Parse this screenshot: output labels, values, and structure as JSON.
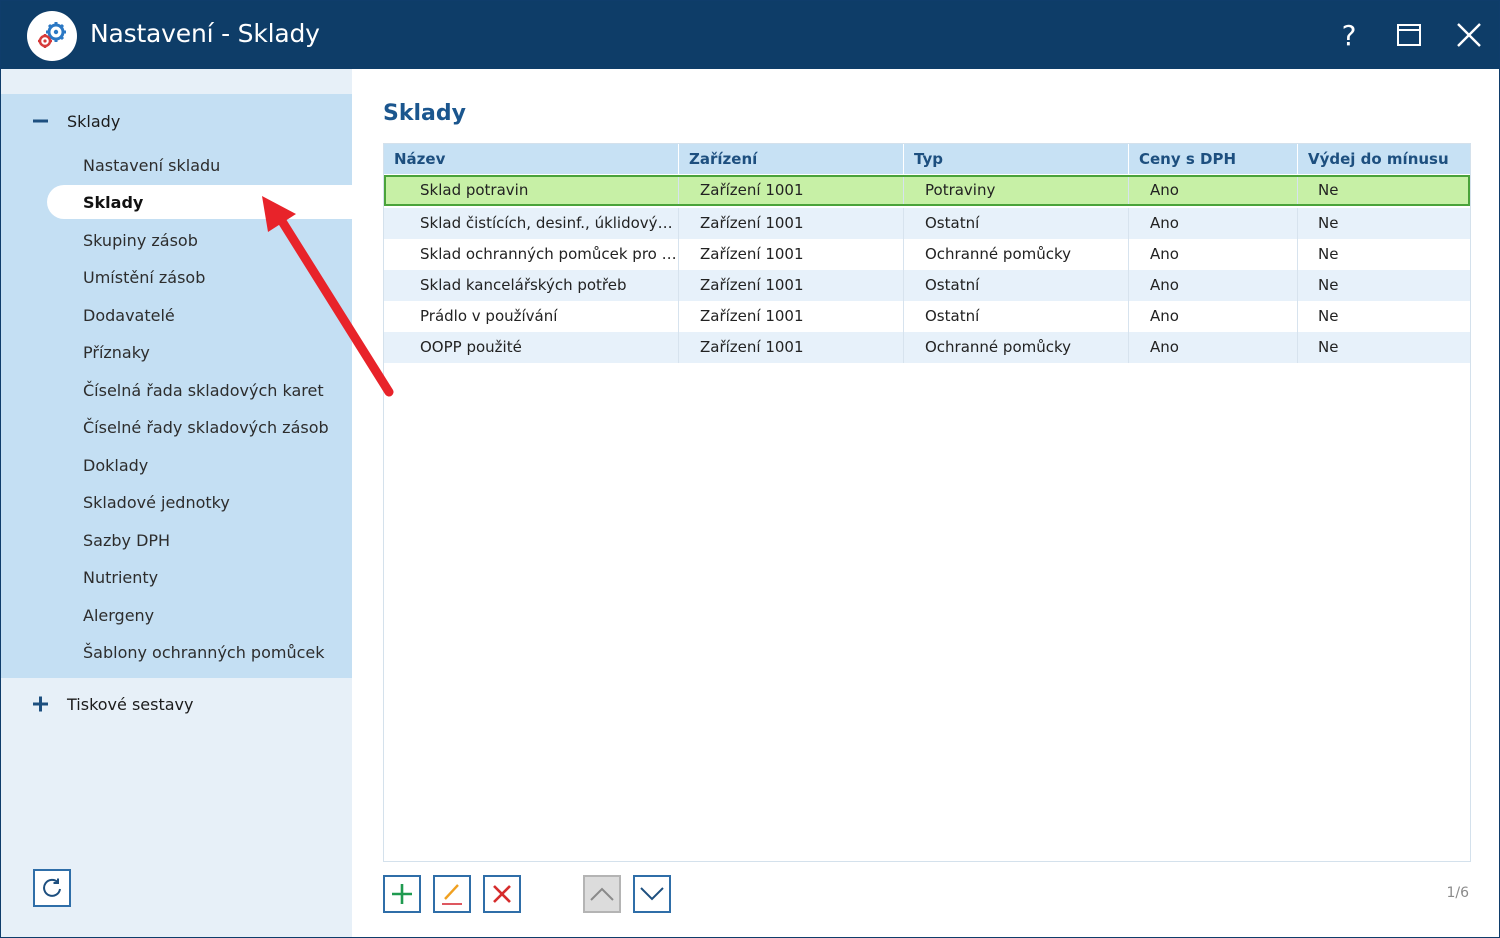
{
  "window": {
    "title": "Nastavení - Sklady",
    "help_label": "?"
  },
  "sidebar": {
    "groups": [
      {
        "label": "Sklady",
        "expanded": true,
        "items": [
          {
            "label": "Nastavení skladu"
          },
          {
            "label": "Sklady",
            "active": true
          },
          {
            "label": "Skupiny zásob"
          },
          {
            "label": "Umístění zásob"
          },
          {
            "label": "Dodavatelé"
          },
          {
            "label": "Příznaky"
          },
          {
            "label": "Číselná řada skladových karet"
          },
          {
            "label": "Číselné řady skladových zásob"
          },
          {
            "label": "Doklady"
          },
          {
            "label": "Skladové jednotky"
          },
          {
            "label": "Sazby DPH"
          },
          {
            "label": "Nutrienty"
          },
          {
            "label": "Alergeny"
          },
          {
            "label": "Šablony ochranných pomůcek"
          }
        ]
      },
      {
        "label": "Tiskové sestavy",
        "expanded": false
      }
    ],
    "refresh_icon": "refresh-icon"
  },
  "main": {
    "title": "Sklady",
    "table": {
      "columns": [
        "Název",
        "Zařízení",
        "Typ",
        "Ceny s DPH",
        "Výdej do mínusu"
      ],
      "rows": [
        {
          "name": "Sklad potravin",
          "device": "Zařízení 1001",
          "type": "Potraviny",
          "vat": "Ano",
          "minus": "Ne",
          "selected": true
        },
        {
          "name": "Sklad čistících, desinf., úklidových prostředků",
          "device": "Zařízení 1001",
          "type": "Ostatní",
          "vat": "Ano",
          "minus": "Ne"
        },
        {
          "name": "Sklad ochranných pomůcek pro zaměstnance",
          "device": "Zařízení 1001",
          "type": "Ochranné pomůcky",
          "vat": "Ano",
          "minus": "Ne"
        },
        {
          "name": "Sklad kancelářských potřeb",
          "device": "Zařízení 1001",
          "type": "Ostatní",
          "vat": "Ano",
          "minus": "Ne"
        },
        {
          "name": "Prádlo v používání",
          "device": "Zařízení 1001",
          "type": "Ostatní",
          "vat": "Ano",
          "minus": "Ne"
        },
        {
          "name": "OOPP použité",
          "device": "Zařízení 1001",
          "type": "Ochranné pomůcky",
          "vat": "Ano",
          "minus": "Ne"
        }
      ]
    },
    "toolbar": {
      "add_icon": "plus-icon",
      "edit_icon": "pencil-icon",
      "delete_icon": "delete-x-icon",
      "up_icon": "chevron-up-icon",
      "down_icon": "chevron-down-icon"
    },
    "pager": "1/6"
  },
  "colors": {
    "titlebar": "#0e3d68",
    "sidebar_group": "#c4dff3",
    "selected_row": "#c7f0a6",
    "selected_border": "#4aa33a",
    "accent": "#2f6ea8",
    "annotation_arrow": "#e8232a"
  }
}
